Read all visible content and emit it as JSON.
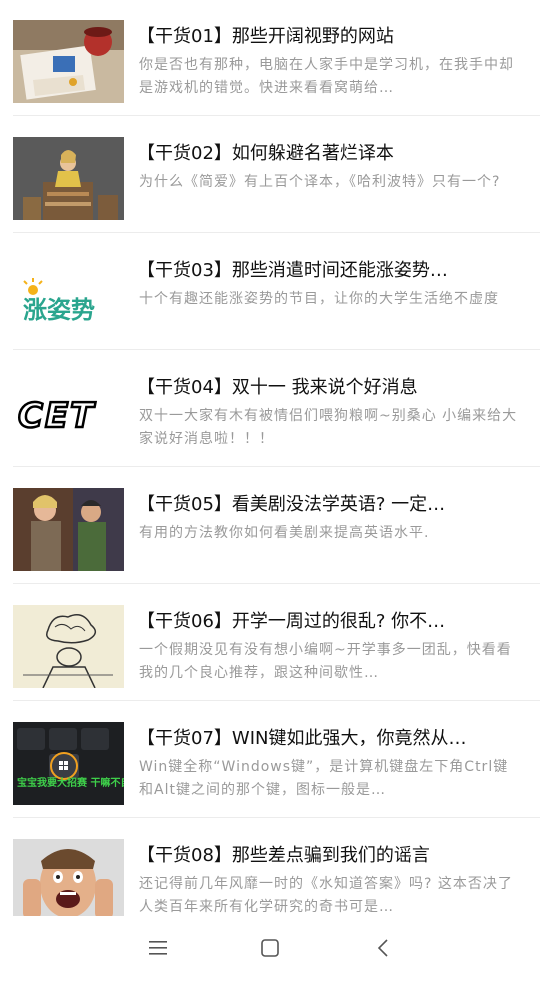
{
  "articles": [
    {
      "title": "【干货01】那些开阔视野的网站",
      "desc": "你是否也有那种，电脑在人家手中是学习机，在我手中却是游戏机的错觉。快进来看看窝萌给…",
      "thumb_icon": "desk-with-coffee-thumbnail"
    },
    {
      "title": "【干货02】如何躲避名著烂译本",
      "desc": "为什么《简爱》有上百个译本，《哈利波特》只有一个?",
      "thumb_icon": "reader-on-book-pile-thumbnail"
    },
    {
      "title": "【干货03】那些消遣时间还能涨姿势…",
      "desc": "十个有趣还能涨姿势的节目，让你的大学生活绝不虚度",
      "thumb_icon": "zhangzishi-logo-thumbnail",
      "thumb_text": "涨姿势"
    },
    {
      "title": "【干货04】双十一 我来说个好消息",
      "desc": "双十一大家有木有被情侣们喂狗粮啊~别桑心 小编来给大家说好消息啦！！！",
      "thumb_icon": "cet-logo-thumbnail",
      "thumb_text": "CET"
    },
    {
      "title": "【干货05】看美剧没法学英语? 一定…",
      "desc": "有用的方法教你如何看美剧来提高英语水平.",
      "thumb_icon": "tv-show-scene-thumbnail"
    },
    {
      "title": "【干货06】开学一周过的很乱? 你不…",
      "desc": "一个假期没见有没有想小编啊~开学事多一团乱，快看看我的几个良心推荐，跟这种间歇性…",
      "thumb_icon": "stressed-sketch-thumbnail"
    },
    {
      "title": "【干货07】WIN键如此强大，你竟然从…",
      "desc": "Win键全称“Windows键”，是计算机键盘左下角Ctrl键和Alt键之间的那个键，图标一般是…",
      "thumb_icon": "keyboard-win-key-thumbnail",
      "thumb_text": "宝宝我要大招赛 干嘛不自拔!"
    },
    {
      "title": "【干货08】那些差点骗到我们的谣言",
      "desc": "还记得前几年风靡一时的《水知道答案》吗? 这本否决了人类百年来所有化学研究的奇书可是…",
      "thumb_icon": "shocked-face-thumbnail"
    }
  ],
  "navbar": {
    "menu_icon": "menu-icon",
    "home_icon": "home-icon",
    "back_icon": "back-icon"
  },
  "colors": {
    "title": "#111111",
    "desc": "#9a9a9a",
    "divider": "#ececec",
    "logo_green": "#2aa58e",
    "logo_yellow": "#f5b21a"
  }
}
